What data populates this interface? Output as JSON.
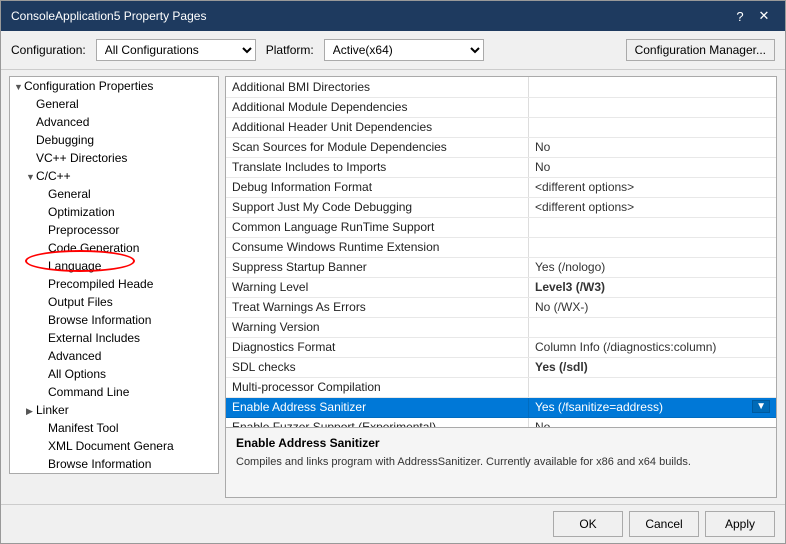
{
  "window": {
    "title": "ConsoleApplication5 Property Pages",
    "help_btn": "?",
    "close_btn": "✕"
  },
  "config_bar": {
    "config_label": "Configuration:",
    "config_value": "All Configurations",
    "platform_label": "Platform:",
    "platform_value": "Active(x64)",
    "manager_btn": "Configuration Manager..."
  },
  "tree": {
    "items": [
      {
        "id": "config-props",
        "label": "Configuration Properties",
        "indent": 0,
        "expanded": true,
        "has_caret": true
      },
      {
        "id": "general",
        "label": "General",
        "indent": 1,
        "expanded": false,
        "has_caret": false
      },
      {
        "id": "advanced",
        "label": "Advanced",
        "indent": 1,
        "expanded": false,
        "has_caret": false
      },
      {
        "id": "debugging",
        "label": "Debugging",
        "indent": 1,
        "expanded": false,
        "has_caret": false
      },
      {
        "id": "vc-dirs",
        "label": "VC++ Directories",
        "indent": 1,
        "expanded": false,
        "has_caret": false
      },
      {
        "id": "cpp",
        "label": "C/C++",
        "indent": 1,
        "expanded": true,
        "has_caret": true
      },
      {
        "id": "cpp-general",
        "label": "General",
        "indent": 2,
        "expanded": false,
        "has_caret": false,
        "selected": false
      },
      {
        "id": "cpp-opt",
        "label": "Optimization",
        "indent": 2,
        "expanded": false,
        "has_caret": false
      },
      {
        "id": "cpp-pre",
        "label": "Preprocessor",
        "indent": 2,
        "expanded": false,
        "has_caret": false
      },
      {
        "id": "cpp-code",
        "label": "Code Generation",
        "indent": 2,
        "expanded": false,
        "has_caret": false
      },
      {
        "id": "cpp-lang",
        "label": "Language",
        "indent": 2,
        "expanded": false,
        "has_caret": false
      },
      {
        "id": "cpp-pch",
        "label": "Precompiled Heade",
        "indent": 2,
        "expanded": false,
        "has_caret": false
      },
      {
        "id": "cpp-out",
        "label": "Output Files",
        "indent": 2,
        "expanded": false,
        "has_caret": false
      },
      {
        "id": "cpp-browse",
        "label": "Browse Information",
        "indent": 2,
        "expanded": false,
        "has_caret": false
      },
      {
        "id": "cpp-ext",
        "label": "External Includes",
        "indent": 2,
        "expanded": false,
        "has_caret": false
      },
      {
        "id": "cpp-adv",
        "label": "Advanced",
        "indent": 2,
        "expanded": false,
        "has_caret": false
      },
      {
        "id": "cpp-allopt",
        "label": "All Options",
        "indent": 2,
        "expanded": false,
        "has_caret": false
      },
      {
        "id": "cpp-cmd",
        "label": "Command Line",
        "indent": 2,
        "expanded": false,
        "has_caret": false
      },
      {
        "id": "linker",
        "label": "Linker",
        "indent": 1,
        "expanded": false,
        "has_caret": true
      },
      {
        "id": "manifest",
        "label": "Manifest Tool",
        "indent": 2,
        "expanded": false,
        "has_caret": false
      },
      {
        "id": "xml-doc",
        "label": "XML Document Genera",
        "indent": 2,
        "expanded": false,
        "has_caret": false
      },
      {
        "id": "browse-info",
        "label": "Browse Information",
        "indent": 2,
        "expanded": false,
        "has_caret": false
      }
    ]
  },
  "properties": {
    "rows": [
      {
        "name": "Additional BMI Directories",
        "value": "",
        "highlighted": false
      },
      {
        "name": "Additional Module Dependencies",
        "value": "",
        "highlighted": false
      },
      {
        "name": "Additional Header Unit Dependencies",
        "value": "",
        "highlighted": false
      },
      {
        "name": "Scan Sources for Module Dependencies",
        "value": "No",
        "highlighted": false
      },
      {
        "name": "Translate Includes to Imports",
        "value": "No",
        "highlighted": false
      },
      {
        "name": "Debug Information Format",
        "value": "<different options>",
        "highlighted": false
      },
      {
        "name": "Support Just My Code Debugging",
        "value": "<different options>",
        "highlighted": false
      },
      {
        "name": "Common Language RunTime Support",
        "value": "",
        "highlighted": false
      },
      {
        "name": "Consume Windows Runtime Extension",
        "value": "",
        "highlighted": false
      },
      {
        "name": "Suppress Startup Banner",
        "value": "Yes (/nologo)",
        "highlighted": false
      },
      {
        "name": "Warning Level",
        "value": "Level3 (/W3)",
        "highlighted": false,
        "bold_value": true
      },
      {
        "name": "Treat Warnings As Errors",
        "value": "No (/WX-)",
        "highlighted": false
      },
      {
        "name": "Warning Version",
        "value": "",
        "highlighted": false
      },
      {
        "name": "Diagnostics Format",
        "value": "Column Info (/diagnostics:column)",
        "highlighted": false
      },
      {
        "name": "SDL checks",
        "value": "Yes (/sdl)",
        "highlighted": false,
        "bold_value": true
      },
      {
        "name": "Multi-processor Compilation",
        "value": "",
        "highlighted": false
      },
      {
        "name": "Enable Address Sanitizer",
        "value": "Yes (/fsanitize=address)",
        "highlighted": true,
        "has_dropdown": true
      },
      {
        "name": "Enable Fuzzer Support (Experimental)",
        "value": "No",
        "highlighted": false
      }
    ]
  },
  "description": {
    "title": "Enable Address Sanitizer",
    "text": "Compiles and links program with AddressSanitizer. Currently available for x86 and x64 builds."
  },
  "footer": {
    "ok_label": "OK",
    "cancel_label": "Cancel",
    "apply_label": "Apply"
  }
}
